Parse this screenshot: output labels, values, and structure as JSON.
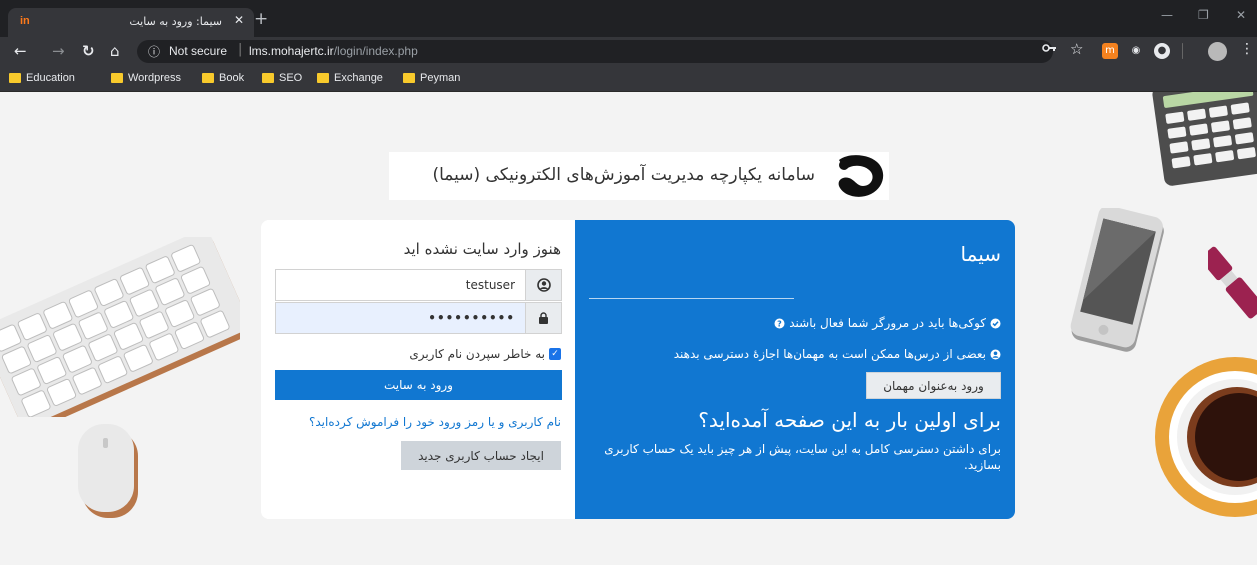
{
  "browser": {
    "tab": {
      "favicon": "in",
      "title": "سیما: ورود به سایت",
      "close": "✕"
    },
    "new_tab": "+",
    "window": {
      "minimize": "—",
      "restore": "❐",
      "close": "✕"
    },
    "nav": {
      "back": "←",
      "forward": "→",
      "reload": "↻",
      "home": "⌂"
    },
    "address": {
      "info": "ⓘ",
      "security": "Not secure",
      "host": "lms.mohajertc.ir",
      "path": "/login/index.php"
    },
    "icons": {
      "key": "key-icon",
      "star": "☆",
      "menu": "⋮"
    },
    "bookmarks": [
      "Education",
      "Wordpress",
      "Book",
      "SEO",
      "Exchange",
      "Peyman"
    ]
  },
  "page": {
    "site_title": "سامانه یکپارچه مدیریت آموزش‌های الکترونیکی (سیما)",
    "login": {
      "heading": "هنوز وارد سایت نشده اید",
      "username_value": "testuser",
      "password_value": "••••••••••",
      "user_icon": "user-icon",
      "lock_icon": "lock-icon",
      "remember_label": "به خاطر سپردن نام کاربری",
      "login_button": "ورود به سایت",
      "forgot_link": "نام کاربری و یا رمز ورود خود را فراموش کرده‌اید؟",
      "create_button": "ایجاد حساب کاربری جدید"
    },
    "info": {
      "title": "سیما",
      "cookies_notice": "کوکی‌ها باید در مرورگر شما فعال باشند",
      "guest_notice": "بعضی از درس‌ها ممکن است به مهمان‌ها اجازهٔ دسترسی بدهند",
      "guest_button": "ورود به‌عنوان مهمان",
      "first_time_heading": "برای اولین بار به این صفحه آمده‌اید؟",
      "first_time_text": "برای داشتن دسترسی کامل به این سایت، پیش از هر چیز باید یک حساب کاربری بسازید."
    },
    "colors": {
      "primary": "#1177d1",
      "background": "#f3f3f3"
    }
  }
}
